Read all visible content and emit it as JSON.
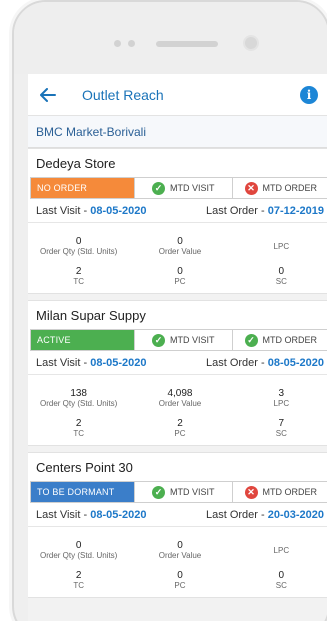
{
  "app": {
    "title": "Outlet Reach",
    "back_icon": "arrow-left-icon",
    "info_icon": "info-icon",
    "info_glyph": "i"
  },
  "location": "BMC Market-Borivali",
  "labels": {
    "mtd_visit": "MTD VISIT",
    "mtd_order": "MTD ORDER",
    "last_visit": "Last Visit - ",
    "last_order": "Last Order - ",
    "order_qty": "Order Qty (Std. Units)",
    "order_value": "Order Value",
    "lpc": "LPC",
    "tc": "TC",
    "pc": "PC",
    "sc": "SC"
  },
  "outlets": [
    {
      "name": "Dedeya Store",
      "status": "NO ORDER",
      "status_color": "#f58a3a",
      "mtd_visit_ok": true,
      "mtd_order_ok": false,
      "last_visit": "08-05-2020",
      "last_order": "07-12-2019",
      "order_qty": "0",
      "order_value": "0",
      "lpc": "",
      "tc": "2",
      "pc": "0",
      "sc": "0"
    },
    {
      "name": "Milan Supar Suppy",
      "status": "ACTIVE",
      "status_color": "#4caf50",
      "mtd_visit_ok": true,
      "mtd_order_ok": true,
      "last_visit": "08-05-2020",
      "last_order": "08-05-2020",
      "order_qty": "138",
      "order_value": "4,098",
      "lpc": "3",
      "tc": "2",
      "pc": "2",
      "sc": "7"
    },
    {
      "name": "Centers Point 30",
      "status": "TO BE DORMANT",
      "status_color": "#3b7ec9",
      "mtd_visit_ok": true,
      "mtd_order_ok": false,
      "last_visit": "08-05-2020",
      "last_order": "20-03-2020",
      "order_qty": "0",
      "order_value": "0",
      "lpc": "",
      "tc": "2",
      "pc": "0",
      "sc": "0"
    }
  ]
}
